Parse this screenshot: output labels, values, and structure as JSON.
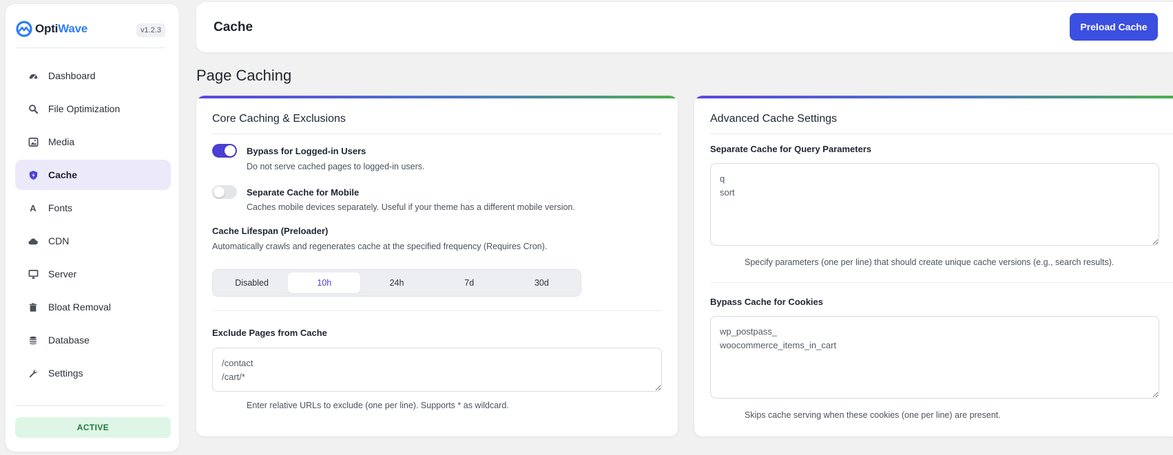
{
  "sidebar": {
    "brand": {
      "name_part1": "Opti",
      "name_part2": "Wave",
      "version": "v1.2.3"
    },
    "items": [
      {
        "label": "Dashboard",
        "icon": "dashboard-icon"
      },
      {
        "label": "File Optimization",
        "icon": "search-icon"
      },
      {
        "label": "Media",
        "icon": "image-icon"
      },
      {
        "label": "Cache",
        "icon": "shield-bolt-icon",
        "active": true
      },
      {
        "label": "Fonts",
        "icon": "font-icon"
      },
      {
        "label": "CDN",
        "icon": "cloud-icon"
      },
      {
        "label": "Server",
        "icon": "monitor-icon"
      },
      {
        "label": "Bloat Removal",
        "icon": "trash-icon"
      },
      {
        "label": "Database",
        "icon": "database-icon"
      },
      {
        "label": "Settings",
        "icon": "wrench-icon"
      }
    ],
    "status": "ACTIVE"
  },
  "header": {
    "title": "Cache",
    "preload_label": "Preload Cache"
  },
  "page_title": "Page Caching",
  "core": {
    "title": "Core Caching & Exclusions",
    "bypass_logged_in": {
      "label": "Bypass for Logged-in Users",
      "help": "Do not serve cached pages to logged-in users.",
      "enabled": true
    },
    "separate_mobile": {
      "label": "Separate Cache for Mobile",
      "help": "Caches mobile devices separately. Useful if your theme has a different mobile version.",
      "enabled": false
    },
    "lifespan": {
      "label": "Cache Lifespan (Preloader)",
      "help": "Automatically crawls and regenerates cache at the specified frequency (Requires Cron).",
      "options": [
        "Disabled",
        "10h",
        "24h",
        "7d",
        "30d"
      ],
      "selected": "10h"
    },
    "exclude": {
      "label": "Exclude Pages from Cache",
      "value": "/contact\n/cart/*",
      "help": "Enter relative URLs to exclude (one per line). Supports * as wildcard."
    }
  },
  "advanced": {
    "title": "Advanced Cache Settings",
    "query_params": {
      "label": "Separate Cache for Query Parameters",
      "value": "q\nsort",
      "help": "Specify parameters (one per line) that should create unique cache versions (e.g., search results)."
    },
    "cookies": {
      "label": "Bypass Cache for Cookies",
      "value": "wp_postpass_\nwoocommerce_items_in_cart",
      "help": "Skips cache serving when these cookies (one per line) are present."
    }
  },
  "colors": {
    "accent": "#3b4fe0",
    "toggle_on": "#4a3fd2",
    "active_nav_bg": "#ece9fb",
    "status_bg": "#dff6e6",
    "status_text": "#1e7b3a"
  }
}
